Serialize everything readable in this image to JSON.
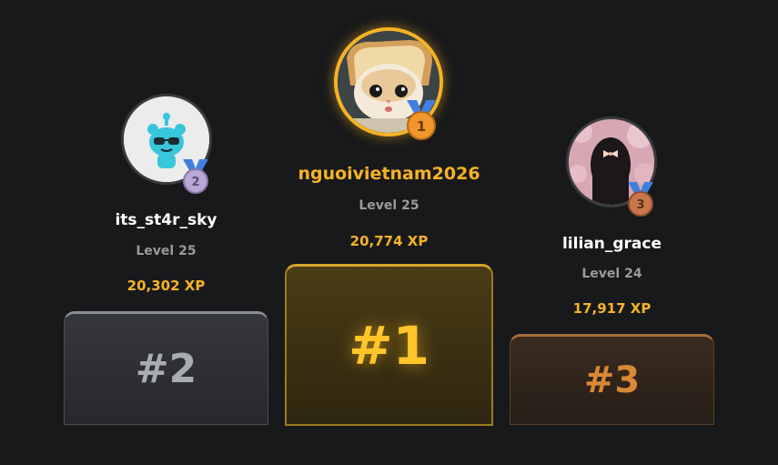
{
  "leaderboard": {
    "players": [
      {
        "rank": 2,
        "username": "its_st4r_sky",
        "level": "Level 25",
        "xp": "20,302 XP",
        "medal_number": "2",
        "podium_label": "#2"
      },
      {
        "rank": 1,
        "username": "nguoivietnam2026",
        "level": "Level 25",
        "xp": "20,774 XP",
        "medal_number": "1",
        "podium_label": "#1"
      },
      {
        "rank": 3,
        "username": "lilian_grace",
        "level": "Level 24",
        "xp": "17,917 XP",
        "medal_number": "3",
        "podium_label": "#3"
      }
    ]
  },
  "colors": {
    "background": "#18191b",
    "gold": "#f5b324",
    "silver": "#a9acb1",
    "bronze": "#d98836",
    "medal_ribbon": "#3f7fe0",
    "medal_silver": "#b9a7d6",
    "medal_gold": "#f0962a",
    "medal_bronze": "#c9774a"
  },
  "icons": {
    "rank_2_avatar": "cyan-bear-sunglasses-avatar",
    "rank_1_avatar": "cat-in-toast-avatar",
    "rank_3_avatar": "girl-cherry-blossom-avatar",
    "medal": "medal-icon"
  }
}
